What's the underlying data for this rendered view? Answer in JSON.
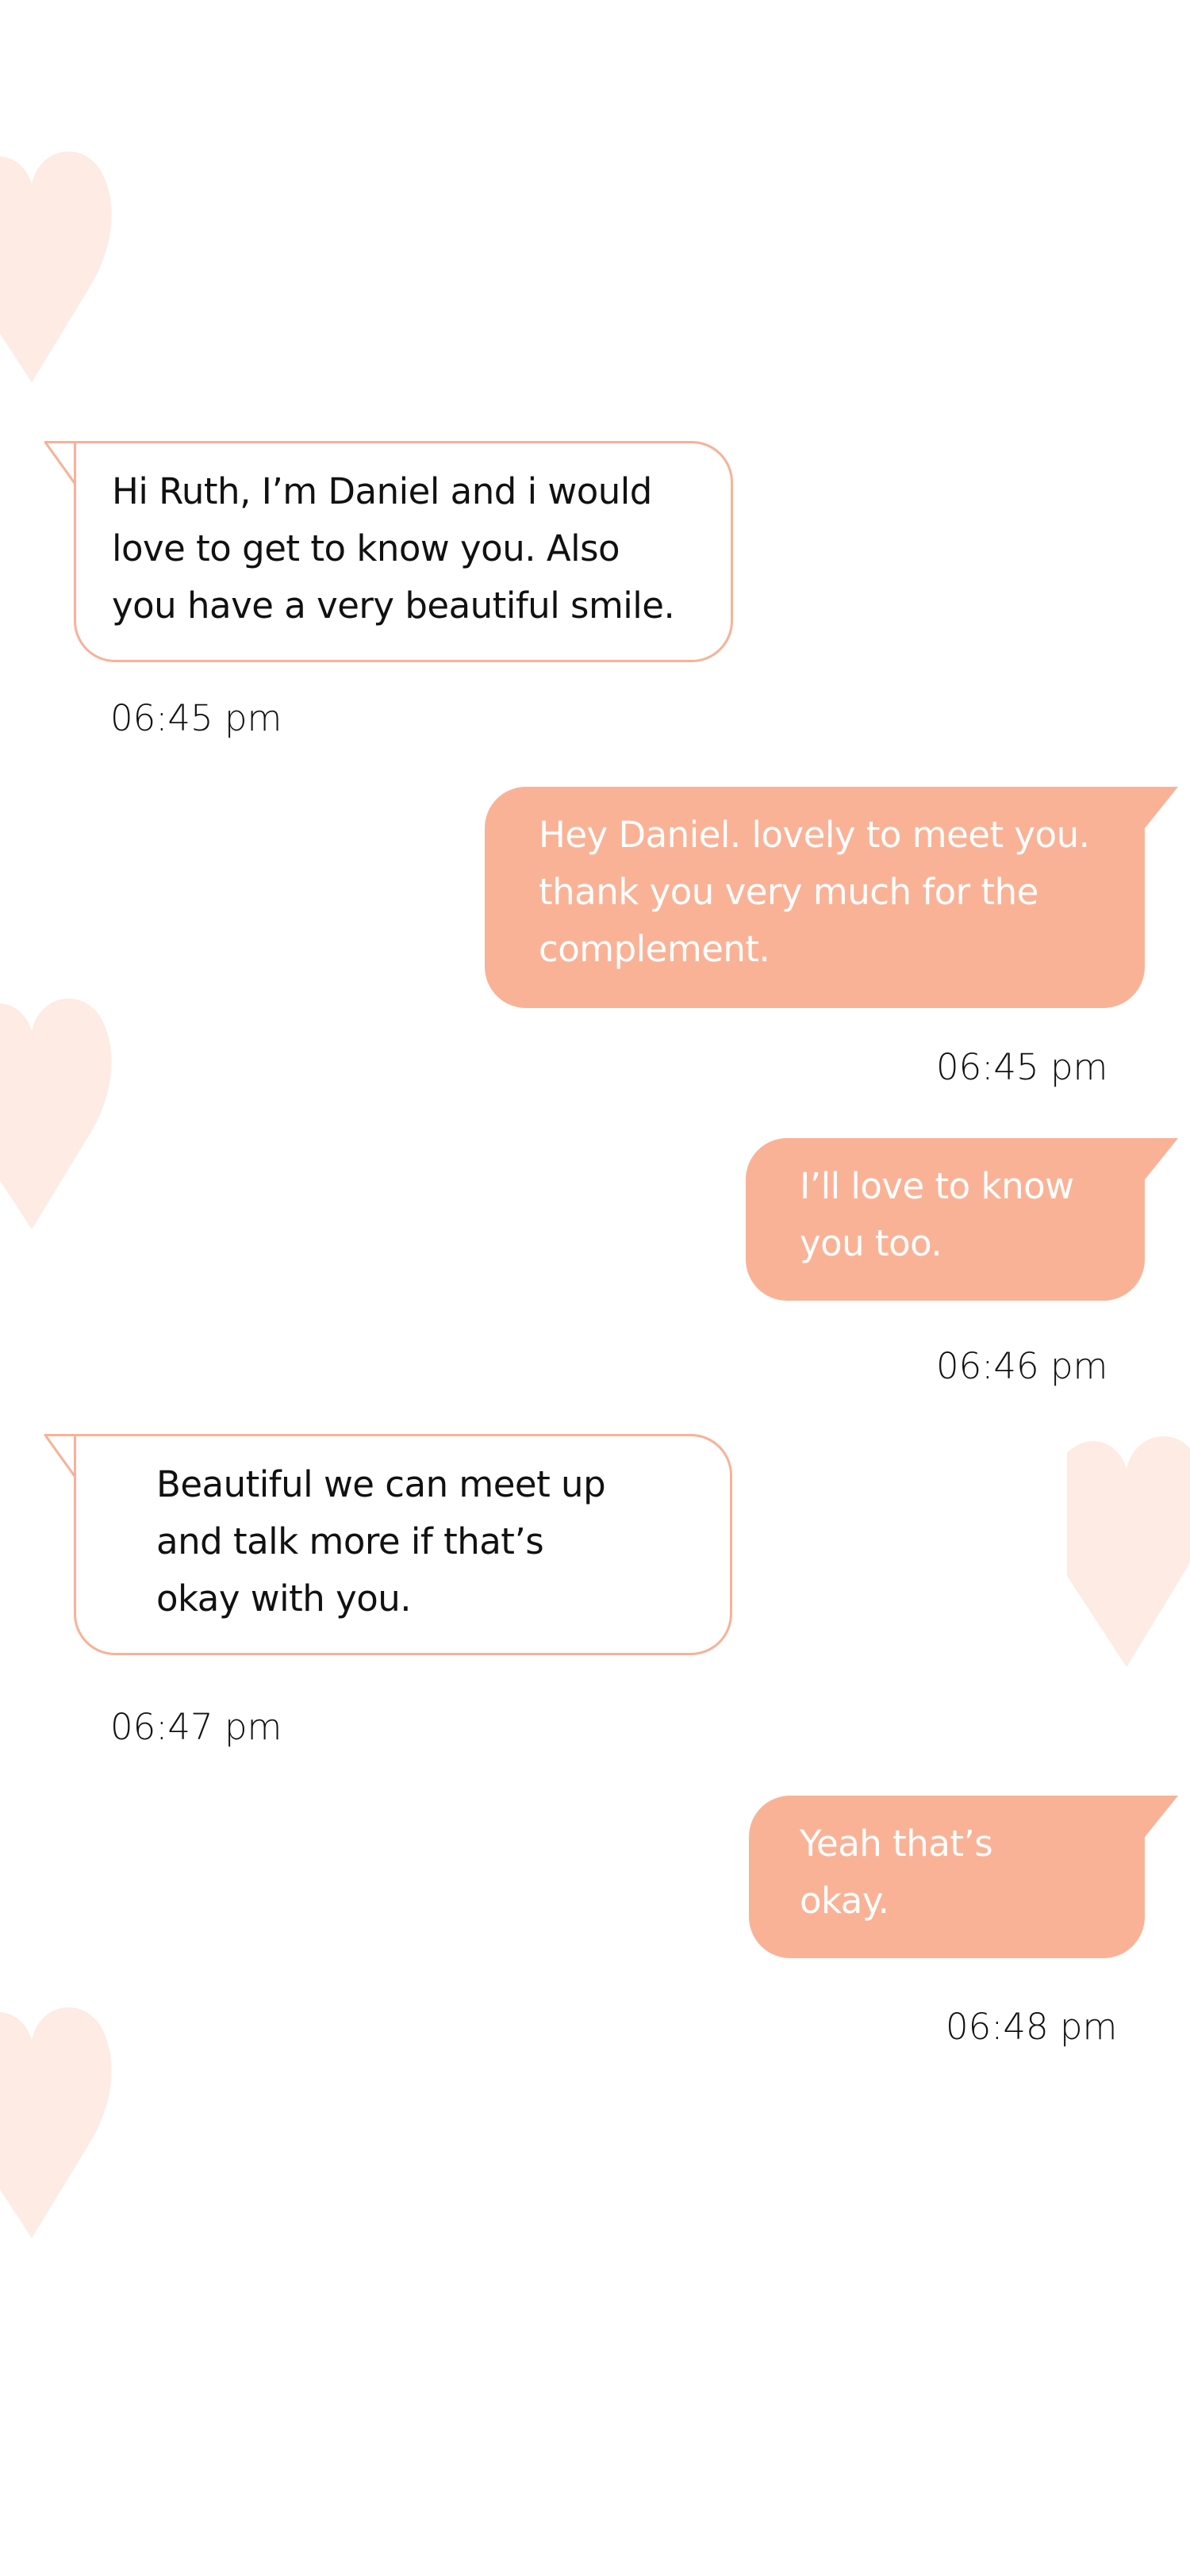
{
  "colors": {
    "accent": "#fab297",
    "heart": "#fdebe4",
    "incoming_border": "#f9b197",
    "background": "#ffffff"
  },
  "messages": [
    {
      "direction": "incoming",
      "text": "Hi Ruth, I’m Daniel and i would\nlove to get to know you. Also\nyou have a very beautiful smile.",
      "time": "06:45 pm"
    },
    {
      "direction": "outgoing",
      "text": "Hey Daniel. lovely to meet you.\nthank you very much for the\ncomplement.",
      "time": "06:45 pm"
    },
    {
      "direction": "outgoing",
      "text": "I’ll love to know\nyou too.",
      "time": "06:46 pm"
    },
    {
      "direction": "incoming",
      "text": "Beautiful we can meet up\nand talk more if that’s\nokay with you.",
      "time": "06:47 pm"
    },
    {
      "direction": "outgoing",
      "text": "Yeah that’s\nokay.",
      "time": "06:48 pm"
    }
  ],
  "decorations": {
    "hearts": [
      "heart-icon",
      "heart-icon",
      "heart-icon",
      "heart-icon"
    ]
  }
}
